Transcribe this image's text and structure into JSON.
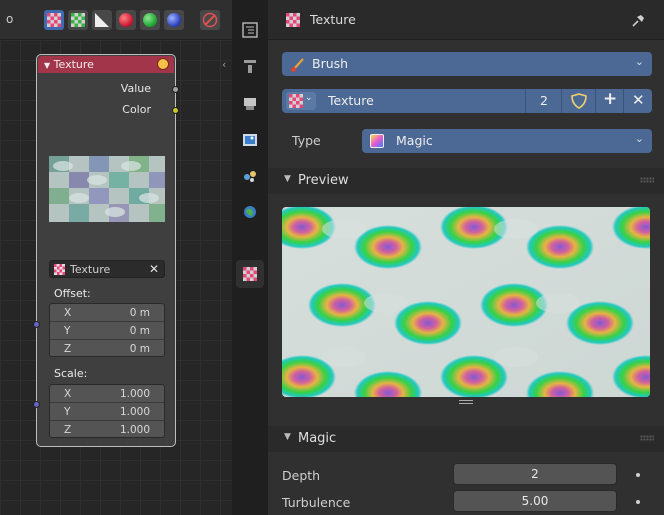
{
  "node_editor": {
    "header": {
      "cut_text": "o"
    },
    "node": {
      "title": "Texture",
      "outputs": [
        "Value",
        "Color"
      ],
      "texture_field": "Texture",
      "offset_label": "Offset:",
      "offset": [
        {
          "axis": "X",
          "value": "0 m"
        },
        {
          "axis": "Y",
          "value": "0 m"
        },
        {
          "axis": "Z",
          "value": "0 m"
        }
      ],
      "scale_label": "Scale:",
      "scale": [
        {
          "axis": "X",
          "value": "1.000"
        },
        {
          "axis": "Y",
          "value": "1.000"
        },
        {
          "axis": "Z",
          "value": "1.000"
        }
      ]
    }
  },
  "props": {
    "header_title": "Texture",
    "brush_label": "Brush",
    "texture_name": "Texture",
    "users_count": "2",
    "type_label": "Type",
    "type_value": "Magic",
    "preview_panel": "Preview",
    "magic_panel": "Magic",
    "depth_label": "Depth",
    "depth_value": "2",
    "turbulence_label": "Turbulence",
    "turbulence_value": "5.00"
  },
  "colors": {
    "accent_field": "#4b6994",
    "node_header": "#a3354b"
  }
}
